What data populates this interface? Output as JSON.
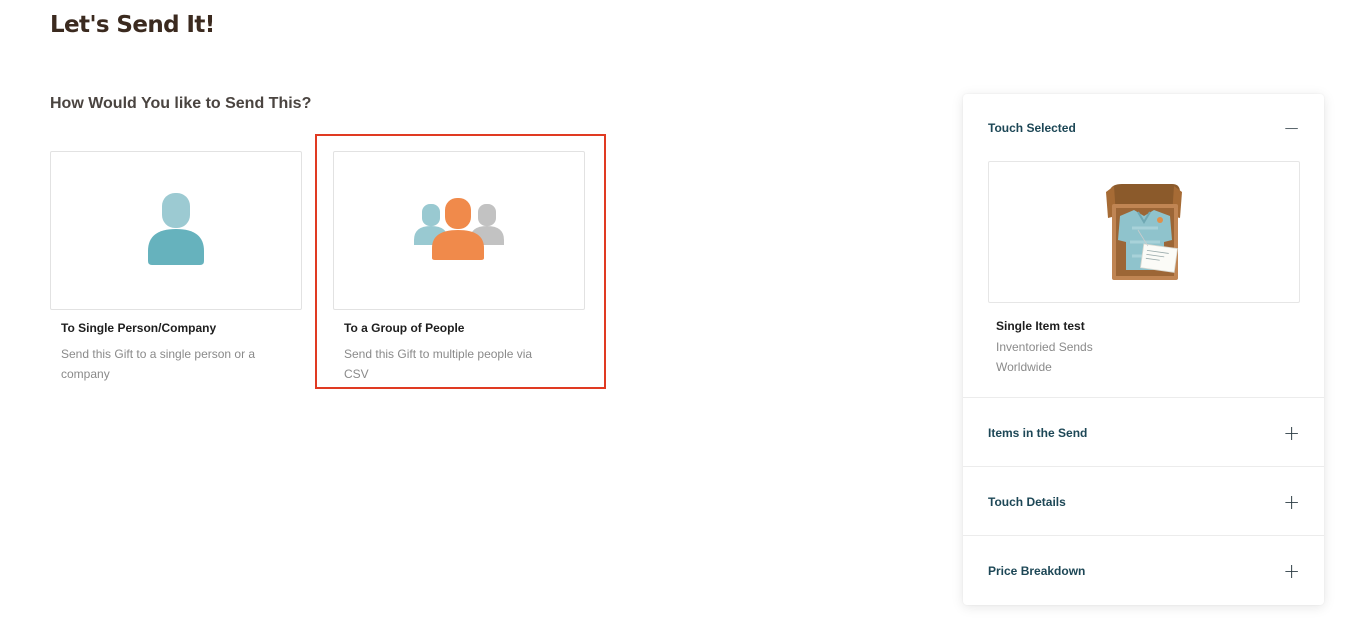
{
  "page": {
    "title": "Let's Send It!",
    "subtitle": "How Would You like to Send This?"
  },
  "options": {
    "single": {
      "title": "To Single Person/Company",
      "description": "Send this Gift to a single person or a company",
      "icon": "single-person-icon"
    },
    "group": {
      "title": "To a Group of People",
      "description": "Send this Gift to multiple people via CSV",
      "icon": "group-people-icon"
    }
  },
  "panel": {
    "touch_selected": {
      "label": "Touch Selected",
      "toggle": "−",
      "product_name": "Single Item test",
      "product_type": "Inventoried Sends",
      "product_region": "Worldwide"
    },
    "items_in_send": {
      "label": "Items in the Send",
      "toggle": "+"
    },
    "touch_details": {
      "label": "Touch Details",
      "toggle": "+"
    },
    "price_breakdown": {
      "label": "Price Breakdown",
      "toggle": "+"
    }
  },
  "colors": {
    "title": "#3b2a1f",
    "highlight": "#e03a22",
    "panel_heading": "#1d4756",
    "single_icon": "#66b2bd",
    "group_icon_main": "#f08a4b",
    "group_icon_left": "#99c9d1",
    "group_icon_right": "#c2c2c2"
  }
}
